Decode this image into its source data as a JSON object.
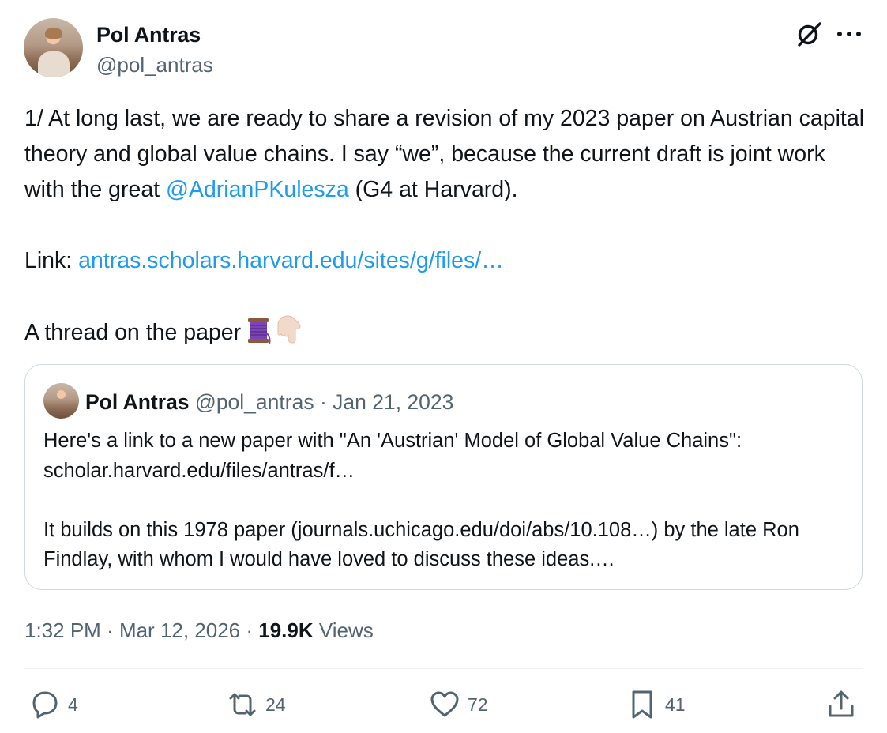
{
  "tweet": {
    "author": {
      "name": "Pol Antras",
      "handle": "@pol_antras"
    },
    "text_before_mention": "1/ At long last, we are ready to share a revision of my 2023 paper on Austrian capital theory and global value chains. I say “we”, because the current draft is joint work with the great ",
    "mention": "@AdrianPKulesza",
    "text_after_mention": " (G4 at Harvard).\n\nLink: ",
    "link": "antras.scholars.harvard.edu/sites/g/files/…",
    "text_thread": "\n\nA thread on the paper",
    "emoji_names": [
      "thread-spool-icon",
      "pointing-down-icon"
    ]
  },
  "quote": {
    "author": {
      "name": "Pol Antras",
      "handle": "@pol_antras"
    },
    "separator": " · ",
    "date": "Jan 21, 2023",
    "text": "Here's a link to a new paper with \"An 'Austrian' Model of Global Value Chains\": scholar.harvard.edu/files/antras/f…\n\nIt builds on this 1978 paper (journals.uchicago.edu/doi/abs/10.108…) by the late Ron Findlay, with whom I would have loved to discuss these ideas.…"
  },
  "meta": {
    "time": "1:32 PM",
    "separator": " · ",
    "date": "Mar 12, 2026",
    "views_count": "19.9K",
    "views_label": " Views"
  },
  "actions": {
    "replies": "4",
    "reposts": "24",
    "likes": "72",
    "bookmarks": "41"
  },
  "colors": {
    "text": "#0f1419",
    "secondary": "#536471",
    "link": "#1d9bf0",
    "border": "#cfd9de"
  }
}
